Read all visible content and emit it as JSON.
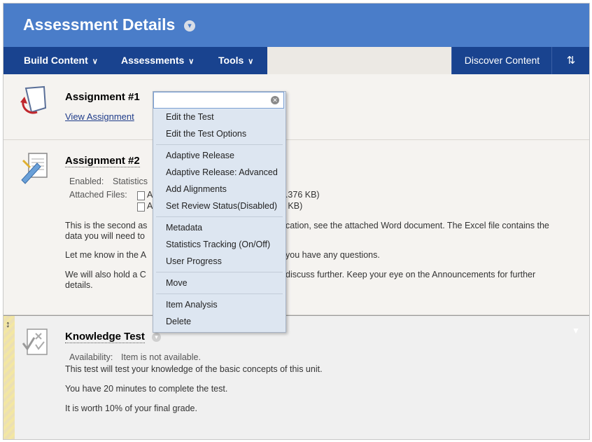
{
  "header": {
    "title": "Assessment Details"
  },
  "nav": {
    "items": [
      "Build Content",
      "Assessments",
      "Tools"
    ],
    "discover": "Discover Content",
    "sort_icon": "sort-icon"
  },
  "items": [
    {
      "title": "Assignment #1",
      "link": "View Assignment",
      "icon": "assignment-icon"
    },
    {
      "title": "Assignment #2",
      "icon": "assignment-ruler-icon",
      "enabled_label": "Enabled:",
      "enabled_value": "Statistics",
      "attached_label": "Attached Files:",
      "file1_partial": "A",
      "file1_size": "2.376 KB)",
      "file2_partial": "A",
      "file2_size": "7 KB)",
      "p1_line1_left": "This is the second as",
      "p1_line1_right": "cation, see the attached Word document.  The Excel file contains the",
      "p1_line2": "data you will need to",
      "p2_left": "Let me know in the A",
      "p2_right": "you have any questions.",
      "p3_line1_left": "We will also hold a C",
      "p3_line1_right": "discuss further.  Keep your eye on the Announcements for further",
      "p3_line2": "details."
    },
    {
      "title": "Knowledge Test",
      "icon": "test-icon",
      "availability_label": "Availability:",
      "availability_value": "Item is not available.",
      "desc1": "This test will  test your knowledge of the basic concepts of this unit.",
      "desc2": "You have 20 minutes to complete the test.",
      "desc3": "It is worth 10% of your final grade."
    }
  ],
  "menu": {
    "search_placeholder": "",
    "groups": [
      [
        "Edit the Test",
        "Edit the Test Options"
      ],
      [
        "Adaptive Release",
        "Adaptive Release: Advanced",
        "Add Alignments",
        "Set Review Status(Disabled)"
      ],
      [
        "Metadata",
        "Statistics Tracking (On/Off)",
        "User Progress"
      ],
      [
        "Move"
      ],
      [
        "Item Analysis",
        "Delete"
      ]
    ]
  }
}
